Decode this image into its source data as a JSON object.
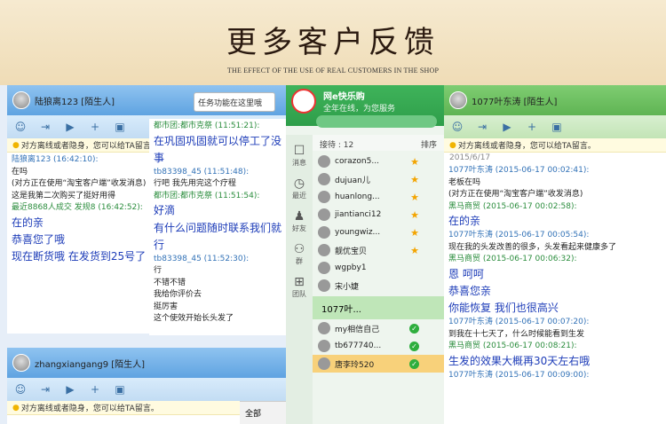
{
  "banner": {
    "title": "更多客户反馈",
    "subtitle": "THE EFFECT OF THE USE OF REAL CUSTOMERS IN THE SHOP"
  },
  "w1": {
    "title": "陆狼离123  [陌生人]",
    "notice": "对方离线或者隐身，您可以给TA留言。",
    "messages": [
      {
        "h": "陆狼离123 (16:42:10):",
        "cls": "hdr-blue"
      },
      {
        "t": "在吗",
        "cls": "plain"
      },
      {
        "t": "(对方正在使用“淘宝客户端”收发消息)",
        "cls": "plain"
      },
      {
        "t": "这是我第二次购买了挺好用得",
        "cls": "plain"
      },
      {
        "h": "最近8868人成交 发规8 (16:42:52):",
        "cls": "hdr-green"
      },
      {
        "t": "在的亲",
        "cls": "big"
      },
      {
        "t": "恭喜您了哦",
        "cls": "big"
      },
      {
        "t": "现在断货哦  在发货到25号了",
        "cls": "big"
      }
    ]
  },
  "tooltip": "任务功能在这里哦",
  "w3": {
    "messages": [
      {
        "h": "都市团:都市克祭 (11:51:21):",
        "cls": "hdr-green"
      },
      {
        "t": "在巩固巩固就可以停工了没事",
        "cls": "big"
      },
      {
        "h": "tb83398_45 (11:51:48):",
        "cls": "hdr-blue"
      },
      {
        "t": "行吧   我先用完这个疗程",
        "cls": "plain"
      },
      {
        "h": "都市团:都市克祭 (11:51:54):",
        "cls": "hdr-green"
      },
      {
        "t": "好滴",
        "cls": "big"
      },
      {
        "t": "有什么问题随时联系我们就行",
        "cls": "big"
      },
      {
        "h": "tb83398_45 (11:52:30):",
        "cls": "hdr-blue"
      },
      {
        "t": "行",
        "cls": "plain"
      },
      {
        "t": "不错不错",
        "cls": "plain"
      },
      {
        "t": "我给你评价去",
        "cls": "plain"
      },
      {
        "t": "挺厉害",
        "cls": "plain"
      },
      {
        "t": "这个使效开始长头发了",
        "cls": "plain"
      }
    ]
  },
  "w2": {
    "title": "zhangxiangang9  [陌生人]",
    "notice": "对方离线或者隐身，您可以给TA留言。",
    "tab": "全部"
  },
  "w4": {
    "name": "网e快乐购",
    "status": "全年在线，为您服务",
    "tab_left": "接待 : 12",
    "tab_right": "排序",
    "side": [
      "消息",
      "最近",
      "好友",
      "群",
      "团队"
    ],
    "contacts": [
      {
        "n": "corazon5...",
        "s": "star"
      },
      {
        "n": "dujuan儿",
        "s": "star"
      },
      {
        "n": "huanlong...",
        "s": "star"
      },
      {
        "n": "jiantianci12",
        "s": "star"
      },
      {
        "n": "youngwiz...",
        "s": "star"
      },
      {
        "n": "靓优宝贝",
        "s": "star"
      },
      {
        "n": "wgpby1",
        "s": ""
      },
      {
        "n": "宋小婕",
        "s": ""
      }
    ],
    "group": "1077叶...",
    "contacts2": [
      {
        "n": "my相信自己",
        "s": "ok"
      },
      {
        "n": "tb677740...",
        "s": "ok"
      },
      {
        "n": "唐李玲520",
        "s": "ok",
        "hl": true
      }
    ]
  },
  "w5": {
    "title": "1077叶东涛  [陌生人]",
    "notice": "对方离线或者隐身，您可以给TA留言。",
    "date": "2015/6/17",
    "messages": [
      {
        "h": "1077叶东涛 (2015-06-17 00:02:41):",
        "cls": "hdr-blue"
      },
      {
        "t": "老板在吗",
        "cls": "plain"
      },
      {
        "t": "(对方正在使用“淘宝客户端”收发消息)",
        "cls": "plain"
      },
      {
        "h": "黑马商贸 (2015-06-17 00:02:58):",
        "cls": "hdr-green"
      },
      {
        "t": "在的亲",
        "cls": "big"
      },
      {
        "h": "1077叶东涛 (2015-06-17 00:05:54):",
        "cls": "hdr-blue"
      },
      {
        "t": "现在我的头发改善的很多，头发看起来健康多了",
        "cls": "plain"
      },
      {
        "h": "黑马商贸 (2015-06-17 00:06:32):",
        "cls": "hdr-green"
      },
      {
        "t": "恩 呵呵",
        "cls": "big"
      },
      {
        "t": "恭喜您亲",
        "cls": "big"
      },
      {
        "t": "你能恢复 我们也很高兴",
        "cls": "big"
      },
      {
        "h": "1077叶东涛 (2015-06-17 00:07:20):",
        "cls": "hdr-blue"
      },
      {
        "t": "到我在十七天了，什么时候能看到生发",
        "cls": "plain"
      },
      {
        "h": "黑马商贸 (2015-06-17 00:08:21):",
        "cls": "hdr-green"
      },
      {
        "t": "生发的效果大概再30天左右哦",
        "cls": "big"
      },
      {
        "h": "1077叶东涛 (2015-06-17 00:09:00):",
        "cls": "hdr-blue"
      }
    ]
  },
  "colors": {
    "accent_blue": "#3272b7",
    "accent_green": "#2b8d3d",
    "highlight": "#f8d17a"
  }
}
